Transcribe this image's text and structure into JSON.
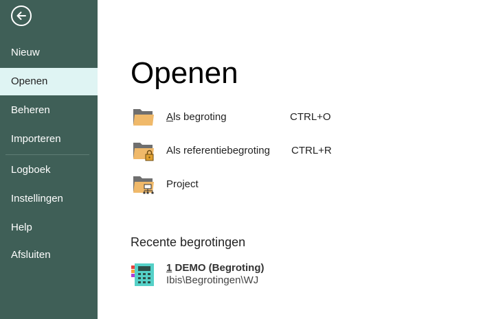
{
  "sidebar": {
    "items": [
      {
        "label": "Nieuw"
      },
      {
        "label": "Openen"
      },
      {
        "label": "Beheren"
      },
      {
        "label": "Importeren"
      },
      {
        "label": "Logboek"
      },
      {
        "label": "Instellingen"
      },
      {
        "label": "Help"
      },
      {
        "label": "Afsluiten"
      }
    ],
    "active_item": "Openen",
    "background": "#3f5f57",
    "active_background": "#dff4f3"
  },
  "main": {
    "title": "Openen",
    "open_options": [
      {
        "label_hotkey": "A",
        "label_rest": "ls begroting",
        "shortcut": "CTRL+O",
        "icon": "folder-icon"
      },
      {
        "label": "Als referentiebegroting",
        "shortcut": "CTRL+R",
        "icon": "folder-lock-icon"
      },
      {
        "label": "Project",
        "icon": "folder-network-icon"
      }
    ],
    "recent_heading": "Recente begrotingen",
    "recent": [
      {
        "hotkey": "1",
        "name": " DEMO (Begroting)",
        "path": "Ibis\\Begrotingen\\WJ",
        "icon": "calculator-icon"
      }
    ],
    "folder_color": "#f0b96a"
  }
}
